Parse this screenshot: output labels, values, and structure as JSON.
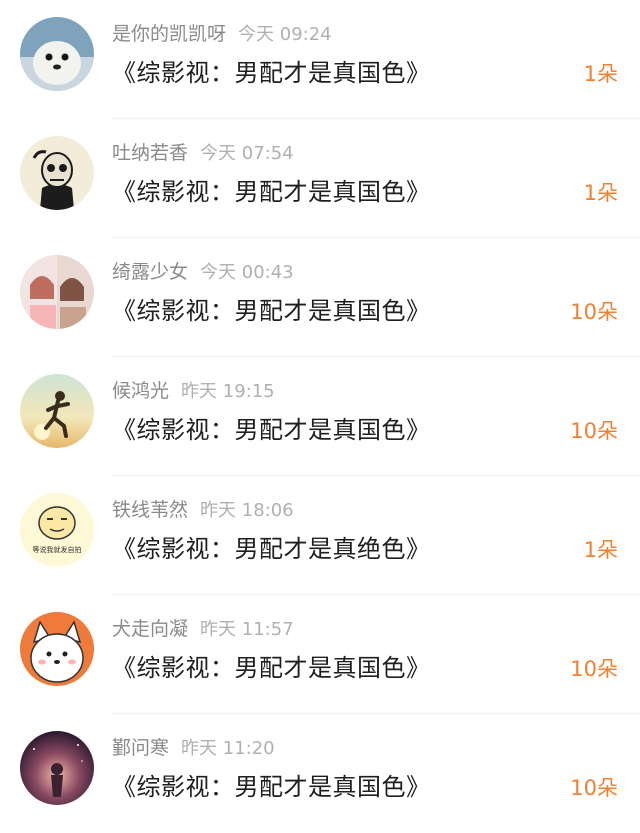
{
  "items": [
    {
      "user": "是你的凯凯呀",
      "time": "今天 09:24",
      "title": "《综影视：男配才是真国色》",
      "gift": "1朵",
      "avatar": "seal-avatar"
    },
    {
      "user": "吐纳若香",
      "time": "今天 07:54",
      "title": "《综影视：男配才是真国色》",
      "gift": "1朵",
      "avatar": "skull-avatar"
    },
    {
      "user": "绮露少女",
      "time": "今天 00:43",
      "title": "《综影视：男配才是真国色》",
      "gift": "10朵",
      "avatar": "girls-photo-avatar"
    },
    {
      "user": "候鸿光",
      "time": "昨天 19:15",
      "title": "《综影视：男配才是真国色》",
      "gift": "10朵",
      "avatar": "runner-silhouette-avatar"
    },
    {
      "user": "铁线苇然",
      "time": "昨天 18:06",
      "title": "《综影视：男配才是真绝色》",
      "gift": "1朵",
      "avatar": "meme-face-avatar"
    },
    {
      "user": "犬走向凝",
      "time": "昨天 11:57",
      "title": "《综影视：男配才是真国色》",
      "gift": "10朵",
      "avatar": "puppy-cartoon-avatar"
    },
    {
      "user": "鄞问寒",
      "time": "昨天 11:20",
      "title": "《综影视：男配才是真国色》",
      "gift": "10朵",
      "avatar": "night-sky-avatar"
    }
  ],
  "avatar_texts": {
    "meme_caption": "等说我就发自拍"
  },
  "colors": {
    "gift": "#f08030",
    "title": "#1f1f1f",
    "username": "#8a8a8a",
    "time": "#b0b0b0",
    "divider": "#f0f0f0"
  }
}
